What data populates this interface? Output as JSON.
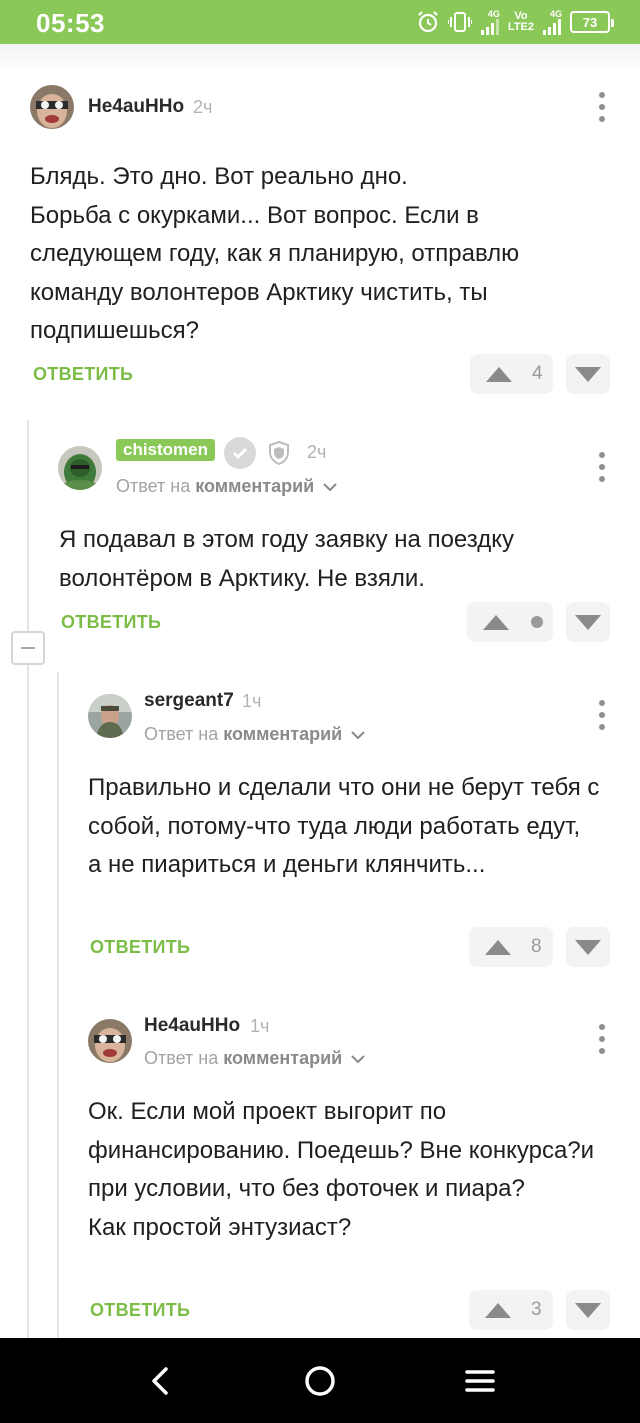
{
  "status_bar": {
    "time": "05:53",
    "net1": "4G",
    "net_vo": "Vo",
    "net_lte": "LTE2",
    "net2": "4G",
    "battery": "73"
  },
  "common": {
    "reply_label": "ОТВЕТИТЬ",
    "reply_to_prefix": "Ответ на",
    "reply_to_target": "комментарий"
  },
  "comments": [
    {
      "author": "He4auHHo",
      "time": "2ч",
      "text": "Блядь. Это дно. Вот реально дно.\nБорьба с окурками... Вот вопрос. Если в следующем году, как я планирую, отправлю команду волонтеров Арктику чистить, ты подпишешься?",
      "rating": "4"
    },
    {
      "author": "chistomen",
      "time": "2ч",
      "text": "Я подавал в этом году заявку на поездку волонтёром в Арктику. Не взяли.",
      "rating": ""
    },
    {
      "author": "sergeant7",
      "time": "1ч",
      "text": "Правильно и сделали что они не берут тебя с собой, потому-что туда люди работать едут, а не пиариться и деньги клянчить...",
      "rating": "8"
    },
    {
      "author": "He4auHHo",
      "time": "1ч",
      "text": "Ок. Если мой проект выгорит по финансированию. Поедешь? Вне конкурса?и при условии, что без фоточек и пиара?\nКак простой энтузиаст?",
      "rating": "3"
    }
  ],
  "colors": {
    "accent": "#8ac858",
    "reply": "#7cbd47",
    "navbar": "#000000"
  }
}
